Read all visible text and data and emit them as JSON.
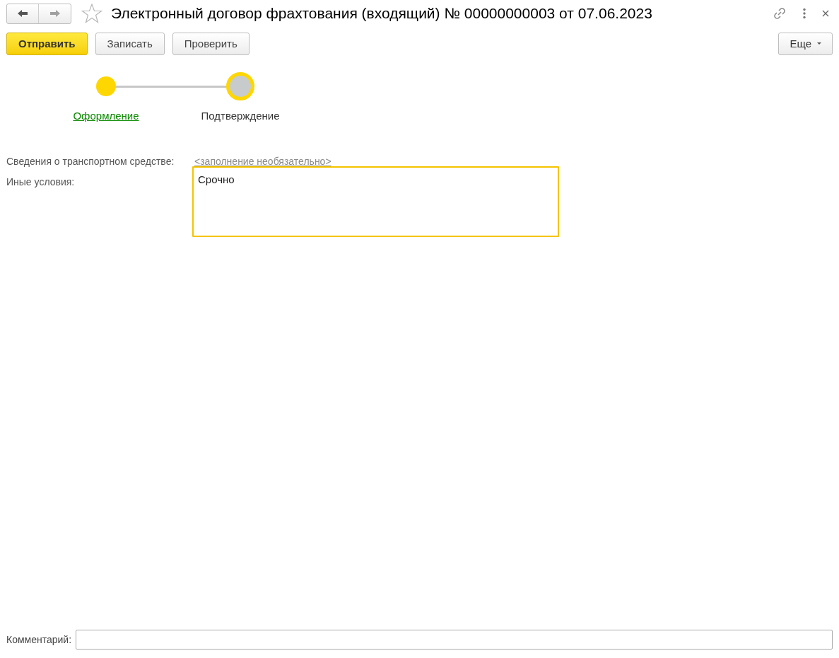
{
  "window": {
    "title": "Электронный договор фрахтования (входящий) № 00000000003 от 07.06.2023",
    "favorite": false
  },
  "toolbar": {
    "buttons": [
      {
        "label": "Отправить",
        "kind": "primary"
      },
      {
        "label": "Записать",
        "kind": "default"
      },
      {
        "label": "Проверить",
        "kind": "default"
      }
    ],
    "more": "Еще"
  },
  "steps": [
    {
      "label": "Оформление",
      "completed": true,
      "current": false
    },
    {
      "label": "Подтверждение",
      "completed": false,
      "current": true
    }
  ],
  "fields": [
    {
      "label": "Сведения о транспортном средстве:",
      "kind": "link",
      "value": "<заполнение необязательно>"
    },
    {
      "label": "Иные условия:",
      "kind": "textarea",
      "value": "Срочно",
      "focused": true
    }
  ],
  "comment": {
    "label": "Комментарий:"
  }
}
